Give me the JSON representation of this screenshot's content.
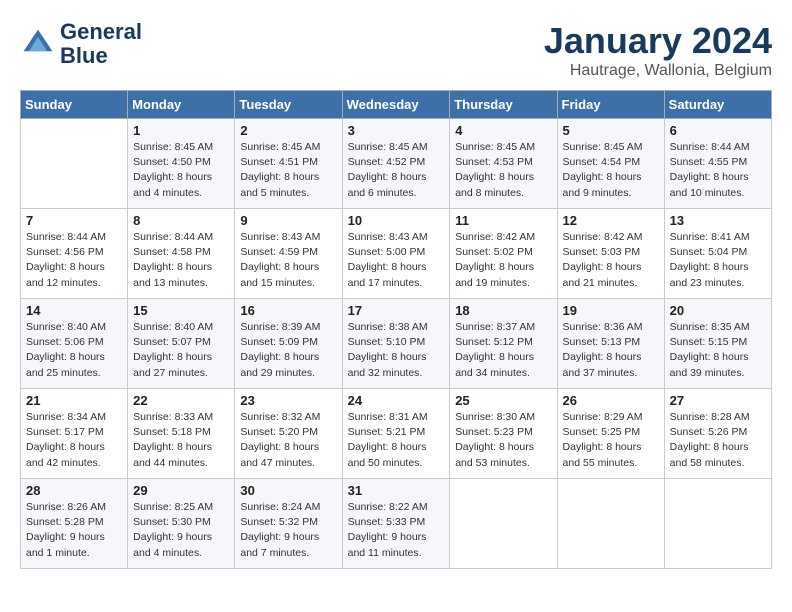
{
  "header": {
    "logo_line1": "General",
    "logo_line2": "Blue",
    "month_title": "January 2024",
    "location": "Hautrage, Wallonia, Belgium"
  },
  "weekdays": [
    "Sunday",
    "Monday",
    "Tuesday",
    "Wednesday",
    "Thursday",
    "Friday",
    "Saturday"
  ],
  "weeks": [
    [
      {
        "day": "",
        "sunrise": "",
        "sunset": "",
        "daylight": ""
      },
      {
        "day": "1",
        "sunrise": "Sunrise: 8:45 AM",
        "sunset": "Sunset: 4:50 PM",
        "daylight": "Daylight: 8 hours and 4 minutes."
      },
      {
        "day": "2",
        "sunrise": "Sunrise: 8:45 AM",
        "sunset": "Sunset: 4:51 PM",
        "daylight": "Daylight: 8 hours and 5 minutes."
      },
      {
        "day": "3",
        "sunrise": "Sunrise: 8:45 AM",
        "sunset": "Sunset: 4:52 PM",
        "daylight": "Daylight: 8 hours and 6 minutes."
      },
      {
        "day": "4",
        "sunrise": "Sunrise: 8:45 AM",
        "sunset": "Sunset: 4:53 PM",
        "daylight": "Daylight: 8 hours and 8 minutes."
      },
      {
        "day": "5",
        "sunrise": "Sunrise: 8:45 AM",
        "sunset": "Sunset: 4:54 PM",
        "daylight": "Daylight: 8 hours and 9 minutes."
      },
      {
        "day": "6",
        "sunrise": "Sunrise: 8:44 AM",
        "sunset": "Sunset: 4:55 PM",
        "daylight": "Daylight: 8 hours and 10 minutes."
      }
    ],
    [
      {
        "day": "7",
        "sunrise": "Sunrise: 8:44 AM",
        "sunset": "Sunset: 4:56 PM",
        "daylight": "Daylight: 8 hours and 12 minutes."
      },
      {
        "day": "8",
        "sunrise": "Sunrise: 8:44 AM",
        "sunset": "Sunset: 4:58 PM",
        "daylight": "Daylight: 8 hours and 13 minutes."
      },
      {
        "day": "9",
        "sunrise": "Sunrise: 8:43 AM",
        "sunset": "Sunset: 4:59 PM",
        "daylight": "Daylight: 8 hours and 15 minutes."
      },
      {
        "day": "10",
        "sunrise": "Sunrise: 8:43 AM",
        "sunset": "Sunset: 5:00 PM",
        "daylight": "Daylight: 8 hours and 17 minutes."
      },
      {
        "day": "11",
        "sunrise": "Sunrise: 8:42 AM",
        "sunset": "Sunset: 5:02 PM",
        "daylight": "Daylight: 8 hours and 19 minutes."
      },
      {
        "day": "12",
        "sunrise": "Sunrise: 8:42 AM",
        "sunset": "Sunset: 5:03 PM",
        "daylight": "Daylight: 8 hours and 21 minutes."
      },
      {
        "day": "13",
        "sunrise": "Sunrise: 8:41 AM",
        "sunset": "Sunset: 5:04 PM",
        "daylight": "Daylight: 8 hours and 23 minutes."
      }
    ],
    [
      {
        "day": "14",
        "sunrise": "Sunrise: 8:40 AM",
        "sunset": "Sunset: 5:06 PM",
        "daylight": "Daylight: 8 hours and 25 minutes."
      },
      {
        "day": "15",
        "sunrise": "Sunrise: 8:40 AM",
        "sunset": "Sunset: 5:07 PM",
        "daylight": "Daylight: 8 hours and 27 minutes."
      },
      {
        "day": "16",
        "sunrise": "Sunrise: 8:39 AM",
        "sunset": "Sunset: 5:09 PM",
        "daylight": "Daylight: 8 hours and 29 minutes."
      },
      {
        "day": "17",
        "sunrise": "Sunrise: 8:38 AM",
        "sunset": "Sunset: 5:10 PM",
        "daylight": "Daylight: 8 hours and 32 minutes."
      },
      {
        "day": "18",
        "sunrise": "Sunrise: 8:37 AM",
        "sunset": "Sunset: 5:12 PM",
        "daylight": "Daylight: 8 hours and 34 minutes."
      },
      {
        "day": "19",
        "sunrise": "Sunrise: 8:36 AM",
        "sunset": "Sunset: 5:13 PM",
        "daylight": "Daylight: 8 hours and 37 minutes."
      },
      {
        "day": "20",
        "sunrise": "Sunrise: 8:35 AM",
        "sunset": "Sunset: 5:15 PM",
        "daylight": "Daylight: 8 hours and 39 minutes."
      }
    ],
    [
      {
        "day": "21",
        "sunrise": "Sunrise: 8:34 AM",
        "sunset": "Sunset: 5:17 PM",
        "daylight": "Daylight: 8 hours and 42 minutes."
      },
      {
        "day": "22",
        "sunrise": "Sunrise: 8:33 AM",
        "sunset": "Sunset: 5:18 PM",
        "daylight": "Daylight: 8 hours and 44 minutes."
      },
      {
        "day": "23",
        "sunrise": "Sunrise: 8:32 AM",
        "sunset": "Sunset: 5:20 PM",
        "daylight": "Daylight: 8 hours and 47 minutes."
      },
      {
        "day": "24",
        "sunrise": "Sunrise: 8:31 AM",
        "sunset": "Sunset: 5:21 PM",
        "daylight": "Daylight: 8 hours and 50 minutes."
      },
      {
        "day": "25",
        "sunrise": "Sunrise: 8:30 AM",
        "sunset": "Sunset: 5:23 PM",
        "daylight": "Daylight: 8 hours and 53 minutes."
      },
      {
        "day": "26",
        "sunrise": "Sunrise: 8:29 AM",
        "sunset": "Sunset: 5:25 PM",
        "daylight": "Daylight: 8 hours and 55 minutes."
      },
      {
        "day": "27",
        "sunrise": "Sunrise: 8:28 AM",
        "sunset": "Sunset: 5:26 PM",
        "daylight": "Daylight: 8 hours and 58 minutes."
      }
    ],
    [
      {
        "day": "28",
        "sunrise": "Sunrise: 8:26 AM",
        "sunset": "Sunset: 5:28 PM",
        "daylight": "Daylight: 9 hours and 1 minute."
      },
      {
        "day": "29",
        "sunrise": "Sunrise: 8:25 AM",
        "sunset": "Sunset: 5:30 PM",
        "daylight": "Daylight: 9 hours and 4 minutes."
      },
      {
        "day": "30",
        "sunrise": "Sunrise: 8:24 AM",
        "sunset": "Sunset: 5:32 PM",
        "daylight": "Daylight: 9 hours and 7 minutes."
      },
      {
        "day": "31",
        "sunrise": "Sunrise: 8:22 AM",
        "sunset": "Sunset: 5:33 PM",
        "daylight": "Daylight: 9 hours and 11 minutes."
      },
      {
        "day": "",
        "sunrise": "",
        "sunset": "",
        "daylight": ""
      },
      {
        "day": "",
        "sunrise": "",
        "sunset": "",
        "daylight": ""
      },
      {
        "day": "",
        "sunrise": "",
        "sunset": "",
        "daylight": ""
      }
    ]
  ]
}
